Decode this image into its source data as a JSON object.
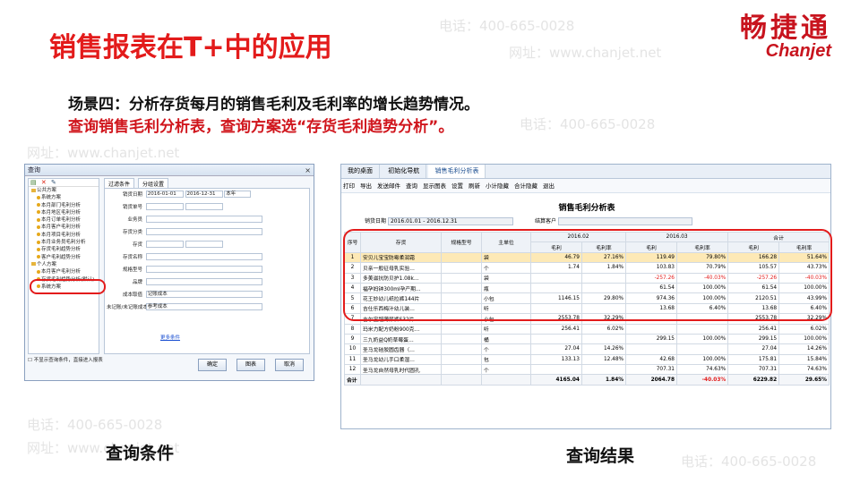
{
  "slide": {
    "title": "销售报表在T+中的应用",
    "logo_cn": "畅捷通",
    "logo_en": "Chanjet",
    "scene_line": "场景四：分析存货每月的销售毛利及毛利率的增长趋势情况。",
    "instruction_line": "查询销售毛利分析表，查询方案选“存货毛利趋势分析”。",
    "caption_left": "查询条件",
    "caption_right": "查询结果",
    "watermark_phone": "电话：400-665-0028",
    "watermark_web": "网址：www.chanjet.net",
    "accent_color": "#e31b1b"
  },
  "query_dialog": {
    "title": "查询",
    "toolbar_icons": [
      "new-icon",
      "delete-icon",
      "edit-icon"
    ],
    "tree": [
      {
        "label": "公共方案",
        "kind": "folder"
      },
      {
        "label": "系统方案",
        "kind": "leaf"
      },
      {
        "label": "本月部门毛利分析",
        "kind": "leaf"
      },
      {
        "label": "本月地区毛利分析",
        "kind": "leaf"
      },
      {
        "label": "本月订单毛利分析",
        "kind": "leaf"
      },
      {
        "label": "本月客户毛利分析",
        "kind": "leaf"
      },
      {
        "label": "本月项目毛利分析",
        "kind": "leaf"
      },
      {
        "label": "本月业务员毛利分析",
        "kind": "leaf"
      },
      {
        "label": "存货毛利趋势分析",
        "kind": "leaf"
      },
      {
        "label": "客户毛利趋势分析",
        "kind": "leaf"
      },
      {
        "label": "个人方案",
        "kind": "folder"
      },
      {
        "label": "本月客户毛利分析",
        "kind": "leaf"
      },
      {
        "label": "存货毛利趋势分析(默认)",
        "kind": "leaf"
      },
      {
        "label": "系统方案",
        "kind": "leaf"
      }
    ],
    "tabs": [
      "过滤条件",
      "分组设置"
    ],
    "fields": {
      "date_label": "销货日期",
      "date_from": "2016-01-01",
      "date_to": "2016-12-31",
      "date_period": "本年",
      "doc_no_label": "销货单号",
      "salesperson_label": "业务员",
      "inventory_class_label": "存货分类",
      "inventory_label": "存货",
      "inventory_name_label": "存货名称",
      "spec_label": "规格型号",
      "brand_label": "品牌",
      "cost_source_label": "成本取值",
      "cost_source_value": "记账成本",
      "unposted_label": "未记账/未记账成本",
      "unposted_value": "参考成本"
    },
    "more_link": "更多条件",
    "footer_checkbox": "不显示查询条件，直接进入报表",
    "buttons": {
      "ok": "确定",
      "chart": "图表",
      "cancel": "取消"
    }
  },
  "result_window": {
    "tabs": [
      "我的桌面",
      "初始化导航",
      "销售毛利分析表"
    ],
    "toolbar": [
      "打印",
      "导出",
      "发送邮件",
      "查询",
      "显示图表",
      "设置",
      "刷新",
      "小计隐藏",
      "合计隐藏",
      "退出"
    ],
    "report_title": "销售毛利分析表",
    "date_label": "销货日期",
    "date_value": "2016.01.01 - 2016.12.31",
    "customer_label": "结算客户",
    "header": {
      "seq": "序号",
      "inventory": "存货",
      "spec": "规格型号",
      "unit": "主单位",
      "period1": "2016.02",
      "period2": "2016.03",
      "total": "合计",
      "profit": "毛利",
      "rate": "毛利率"
    },
    "rows": [
      {
        "seq": "1",
        "name": "安贝儿宝宝防霉柔润霜",
        "unit": "袋",
        "p1": "46.79",
        "r1": "27.16%",
        "p2": "119.49",
        "r2": "79.80%",
        "pt": "166.28",
        "rt": "51.64%"
      },
      {
        "seq": "2",
        "name": "贝亲一般征母乳实验…",
        "unit": "个",
        "p1": "1.74",
        "r1": "1.84%",
        "p2": "103.83",
        "r2": "70.79%",
        "pt": "105.57",
        "rt": "43.73%"
      },
      {
        "seq": "3",
        "name": "多美滋抗防贝护1.08k…",
        "unit": "袋",
        "p1": "",
        "r1": "",
        "p2": "-257.26",
        "r2": "-40.03%",
        "pt": "-257.26",
        "rt": "-40.03%"
      },
      {
        "seq": "4",
        "name": "福孕妈钟300ml孕产期…",
        "unit": "瓶",
        "p1": "",
        "r1": "",
        "p2": "61.54",
        "r2": "100.00%",
        "pt": "61.54",
        "rt": "100.00%"
      },
      {
        "seq": "5",
        "name": "花王妙幼儿纸拉裤144片",
        "unit": "小包",
        "p1": "1146.15",
        "r1": "29.80%",
        "p2": "974.36",
        "r2": "100.00%",
        "pt": "2120.51",
        "rt": "43.99%"
      },
      {
        "seq": "6",
        "name": "吉仕乐西梅汁幼儿装…",
        "unit": "听",
        "p1": "",
        "r1": "",
        "p2": "13.68",
        "r2": "6.40%",
        "pt": "13.68",
        "rt": "6.40%"
      },
      {
        "seq": "7",
        "name": "吉尔宝超薄尿裤S32片",
        "unit": "小包",
        "p1": "2553.78",
        "r1": "32.29%",
        "p2": "",
        "r2": "",
        "pt": "2553.78",
        "rt": "32.29%"
      },
      {
        "seq": "8",
        "name": "玛米力配方奶粉900克…",
        "unit": "听",
        "p1": "256.41",
        "r1": "6.02%",
        "p2": "",
        "r2": "",
        "pt": "256.41",
        "rt": "6.02%"
      },
      {
        "seq": "9",
        "name": "三九奶益Q奶草莓蛋…",
        "unit": "桶",
        "p1": "",
        "r1": "",
        "p2": "299.15",
        "r2": "100.00%",
        "pt": "299.15",
        "rt": "100.00%"
      },
      {
        "seq": "10",
        "name": "圣马龙硅胶圆齿器（…",
        "unit": "个",
        "p1": "27.04",
        "r1": "14.26%",
        "p2": "",
        "r2": "",
        "pt": "27.04",
        "rt": "14.26%"
      },
      {
        "seq": "11",
        "name": "圣马龙幼儿手口柔湿…",
        "unit": "包",
        "p1": "133.13",
        "r1": "12.48%",
        "p2": "42.68",
        "r2": "100.00%",
        "pt": "175.81",
        "rt": "15.84%"
      },
      {
        "seq": "12",
        "name": "圣马龙自然母乳时代圆孔",
        "unit": "个",
        "p1": "",
        "r1": "",
        "p2": "707.31",
        "r2": "74.63%",
        "pt": "707.31",
        "rt": "74.63%"
      }
    ],
    "total_row": {
      "label": "合计",
      "p1": "4165.04",
      "r1": "1.84%",
      "p2": "2064.78",
      "r2": "-40.03%",
      "pt": "6229.82",
      "rt": "29.65%"
    }
  }
}
